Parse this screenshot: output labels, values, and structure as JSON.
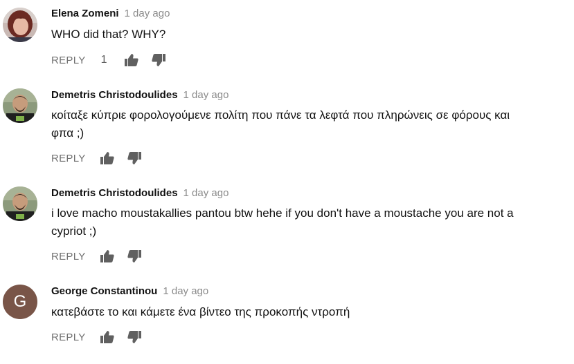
{
  "reply_label": "REPLY",
  "comments": [
    {
      "author": "Elena Zomeni",
      "time": "1 day ago",
      "text": "WHO did that? WHY?",
      "likes": "1",
      "avatar": {
        "type": "photo"
      }
    },
    {
      "author": "Demetris Christodoulides",
      "time": "1 day ago",
      "text": "κοίταξε κύπριε φορολογούμενε πολίτη που πάνε τα λεφτά που πληρώνεις σε φόρους και φπα ;)",
      "avatar": {
        "type": "photo"
      }
    },
    {
      "author": "Demetris Christodoulides",
      "time": "1 day ago",
      "text": "i love macho moustakallies pantou btw hehe if you don't have a moustache you are not a cypriot ;)",
      "avatar": {
        "type": "photo"
      }
    },
    {
      "author": "George Constantinou",
      "time": "1 day ago",
      "text": "κατεβάστε το και κάμετε ένα βίντεο της προκοπής ντροπή",
      "avatar": {
        "type": "letter",
        "letter": "G",
        "color": "#795548"
      }
    }
  ],
  "icons": {
    "like": "thumbs-up-icon",
    "dislike": "thumbs-down-icon"
  },
  "colors": {
    "author": "#111111",
    "timestamp": "#8a8a8a",
    "reply": "#707070",
    "icon": "#606060"
  }
}
